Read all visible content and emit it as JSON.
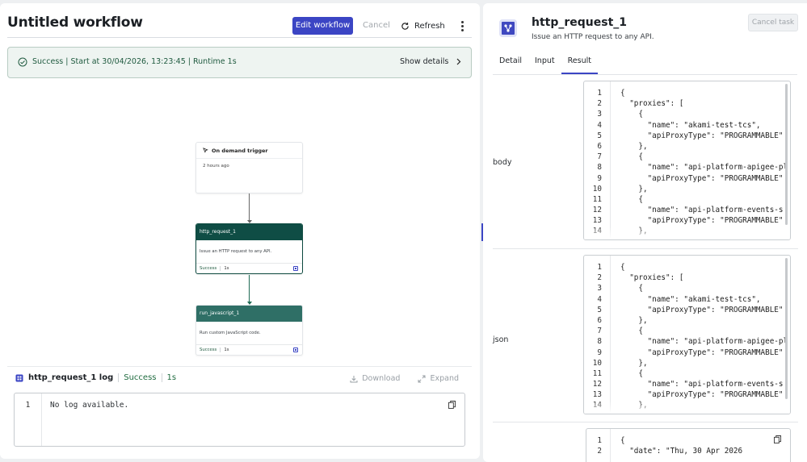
{
  "workflow": {
    "title": "Untitled workflow",
    "edit_label": "Edit workflow",
    "cancel_label": "Cancel",
    "refresh_label": "Refresh"
  },
  "status_banner": {
    "text": "Success | Start at 30/04/2026, 13:23:45 | Runtime 1s",
    "show_details": "Show details"
  },
  "nodes": {
    "trigger": {
      "title": "On demand trigger",
      "time": "2 hours ago"
    },
    "task1": {
      "title": "http_request_1",
      "desc": "Issue an HTTP request to any API.",
      "status": "Success",
      "duration": "1s"
    },
    "task2": {
      "title": "run_javascript_1",
      "desc": "Run custom JavaScript code.",
      "status": "Success",
      "duration": "1s"
    }
  },
  "log": {
    "name": "http_request_1 log",
    "status": "Success",
    "duration": "1s",
    "download": "Download",
    "expand": "Expand",
    "line_number": "1",
    "text": "No log available."
  },
  "task_panel": {
    "title": "http_request_1",
    "subtitle": "Issue an HTTP request to any API.",
    "cancel_task": "Cancel task",
    "tabs": [
      "Detail",
      "Input",
      "Result"
    ],
    "active_tab": "Result",
    "accent_color": "#3b45c4"
  },
  "result": {
    "body_label": "body",
    "json_label": "json",
    "body_lines": [
      "{",
      "  \"proxies\": [",
      "    {",
      "      \"name\": \"akami-test-tcs\",",
      "      \"apiProxyType\": \"PROGRAMMABLE\"",
      "    },",
      "    {",
      "      \"name\": \"api-platform-apigee-pl",
      "      \"apiProxyType\": \"PROGRAMMABLE\"",
      "    },",
      "    {",
      "      \"name\": \"api-platform-events-s",
      "      \"apiProxyType\": \"PROGRAMMABLE\"",
      "    },"
    ],
    "headers_lines": [
      "{",
      "  \"date\": \"Thu, 30 Apr 2026"
    ]
  }
}
